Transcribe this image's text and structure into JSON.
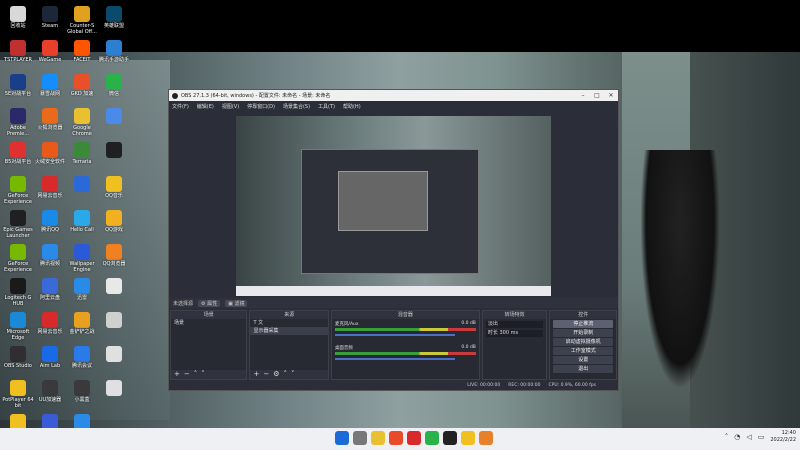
{
  "desktop": {
    "icons": [
      {
        "label": "回收站",
        "color": "#d8d8d8"
      },
      {
        "label": "Steam",
        "color": "#1b2838"
      },
      {
        "label": "Counter-S Global Off...",
        "color": "#e0a020"
      },
      {
        "label": "英雄联盟",
        "color": "#0a4a6a"
      },
      {
        "label": "TSTPLAYER",
        "color": "#c03030"
      },
      {
        "label": "WeGame",
        "color": "#e8402a"
      },
      {
        "label": "FACEIT",
        "color": "#ff5500"
      },
      {
        "label": "腾讯手游助手",
        "color": "#2d7fd1"
      },
      {
        "label": "5E对战平台",
        "color": "#1a3f8a"
      },
      {
        "label": "暴雪战网",
        "color": "#148eff"
      },
      {
        "label": "GKD 加速",
        "color": "#e8502a"
      },
      {
        "label": "微信",
        "color": "#2ab24a"
      },
      {
        "label": "Adobe Premie...",
        "color": "#2a2a6a"
      },
      {
        "label": "火狐浏览器",
        "color": "#e86a1a"
      },
      {
        "label": "Google Chrome",
        "color": "#e8c030"
      },
      {
        "label": "",
        "color": "#4a8ae8"
      },
      {
        "label": "B5对战平台",
        "color": "#e03030"
      },
      {
        "label": "火绒安全软件",
        "color": "#e85a1a"
      },
      {
        "label": "Terraria",
        "color": "#3a8a3a"
      },
      {
        "label": "",
        "color": "#202020"
      },
      {
        "label": "GeForce Experience",
        "color": "#76b900"
      },
      {
        "label": "网易云音乐",
        "color": "#d82a2a"
      },
      {
        "label": "",
        "color": "#2a6ad8"
      },
      {
        "label": "QQ音乐",
        "color": "#f0c020"
      },
      {
        "label": "Epic Games Launcher",
        "color": "#202020"
      },
      {
        "label": "腾讯QQ",
        "color": "#1a8ae8"
      },
      {
        "label": "Hello Call",
        "color": "#2aa8e8"
      },
      {
        "label": "QQ游戏",
        "color": "#f0b020"
      },
      {
        "label": "GeForce Experience",
        "color": "#76b900"
      },
      {
        "label": "腾讯视频",
        "color": "#2a8ae8"
      },
      {
        "label": "Wallpaper Engine",
        "color": "#2a5ad8"
      },
      {
        "label": "QQ浏览器",
        "color": "#f08020"
      },
      {
        "label": "Logitech G HUB",
        "color": "#1a1a1a"
      },
      {
        "label": "阿里云盘",
        "color": "#3a6ad8"
      },
      {
        "label": "迅雷",
        "color": "#2a8ae8"
      },
      {
        "label": "",
        "color": "#e8e8e8"
      },
      {
        "label": "Microsoft Edge",
        "color": "#1a8ad8"
      },
      {
        "label": "网易云音乐",
        "color": "#d82a2a"
      },
      {
        "label": "金铲铲之战",
        "color": "#e8a020"
      },
      {
        "label": "",
        "color": "#d0d0d0"
      },
      {
        "label": "OBS Studio",
        "color": "#302e31"
      },
      {
        "label": "Aim Lab",
        "color": "#1a6ae8"
      },
      {
        "label": "腾讯会议",
        "color": "#2a7ae8"
      },
      {
        "label": "",
        "color": "#e0e0e0"
      },
      {
        "label": "PotPlayer 64 bit",
        "color": "#f0c020"
      },
      {
        "label": "UU加速器",
        "color": "#3a3a3a"
      },
      {
        "label": "小黑盒",
        "color": "#3a3a3a"
      },
      {
        "label": "",
        "color": "#e0e0e0"
      },
      {
        "label": "QQ音乐",
        "color": "#f0c020"
      },
      {
        "label": "Clash for Windows",
        "color": "#3a5ad8"
      },
      {
        "label": "迅雷",
        "color": "#2a8ae8"
      }
    ]
  },
  "obs": {
    "title": "OBS 27.1.3 (64-bit, windows) - 配置文件: 未命名 - 场景: 未命名",
    "menu": [
      "文件(F)",
      "编辑(E)",
      "视图(V)",
      "停靠窗口(D)",
      "场景集合(S)",
      "工具(T)",
      "帮助(H)"
    ],
    "no_source_selected": "未选择源",
    "properties_label": "属性",
    "filters_label": "滤镜",
    "docks": {
      "scenes": {
        "title": "场景",
        "items": [
          "场景"
        ]
      },
      "sources": {
        "title": "来源",
        "items": [
          "T 文",
          "显示器采集"
        ]
      },
      "mixer": {
        "title": "混音器",
        "tracks": [
          {
            "name": "麦克风/Aux",
            "db": "0.0 dB"
          },
          {
            "name": "桌面音频",
            "db": "0.0 dB"
          }
        ]
      },
      "transitions": {
        "title": "转场特效",
        "type": "淡出",
        "duration_label": "时长",
        "duration": "300 ms"
      },
      "controls": {
        "title": "控件",
        "buttons": [
          "停止推流",
          "开始录制",
          "启动虚拟摄像机",
          "工作室模式",
          "设置",
          "退出"
        ]
      }
    },
    "status": {
      "live": "LIVE: 00:00:00",
      "rec": "REC: 00:00:00",
      "cpu": "CPU: 0.9%, 60.00 fps"
    }
  },
  "taskbar": {
    "time": "12:40",
    "date": "2022/2/22"
  }
}
